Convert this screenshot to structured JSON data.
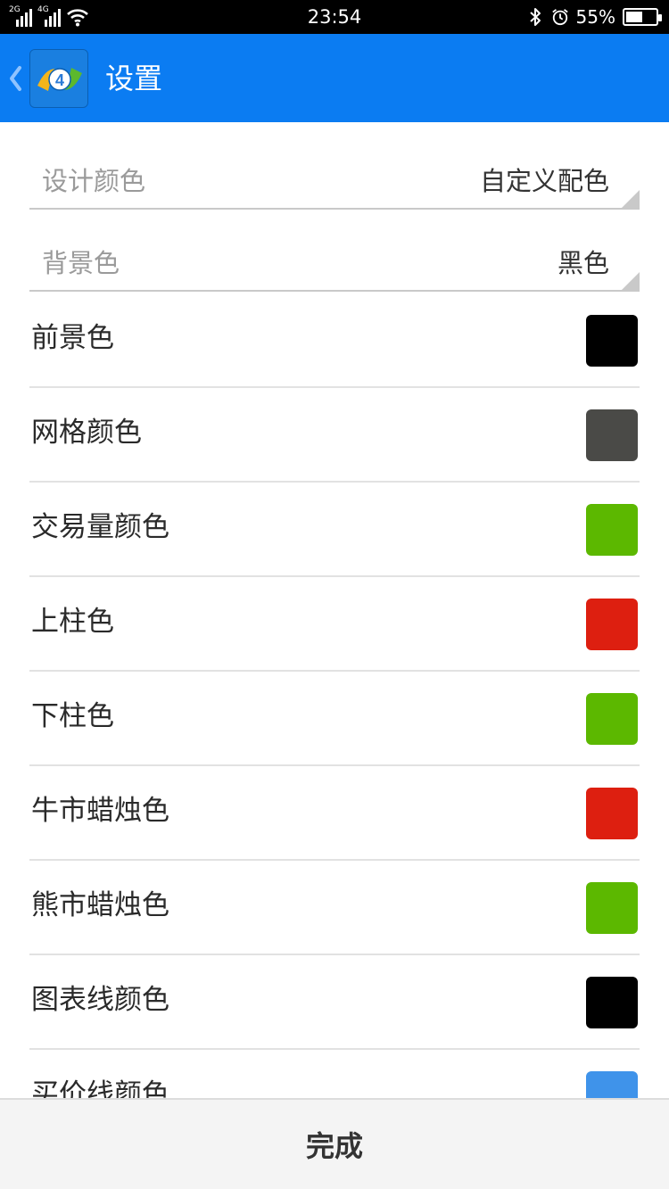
{
  "status_bar": {
    "sim1_network": "2G",
    "sim2_network": "4G",
    "time": "23:54",
    "battery_text": "55%",
    "battery_level": 0.55,
    "icons": [
      "signal-icon",
      "wifi-icon",
      "bluetooth-icon",
      "alarm-icon",
      "battery-icon"
    ]
  },
  "header": {
    "title": "设置",
    "logo_text": "4",
    "accent_color": "#0b7cf2"
  },
  "dropdowns": [
    {
      "label": "设计颜色",
      "value": "自定义配色"
    },
    {
      "label": "背景色",
      "value": "黑色"
    }
  ],
  "color_rows": [
    {
      "label": "前景色",
      "color": "#000000"
    },
    {
      "label": "网格颜色",
      "color": "#4a4a47"
    },
    {
      "label": "交易量颜色",
      "color": "#5cb800"
    },
    {
      "label": "上柱色",
      "color": "#dd1f10"
    },
    {
      "label": "下柱色",
      "color": "#5cb800"
    },
    {
      "label": "牛市蜡烛色",
      "color": "#dd1f10"
    },
    {
      "label": "熊市蜡烛色",
      "color": "#5cb800"
    },
    {
      "label": "图表线颜色",
      "color": "#000000"
    },
    {
      "label": "买价线颜色",
      "color": "#3f93ea"
    }
  ],
  "footer": {
    "done_label": "完成"
  }
}
